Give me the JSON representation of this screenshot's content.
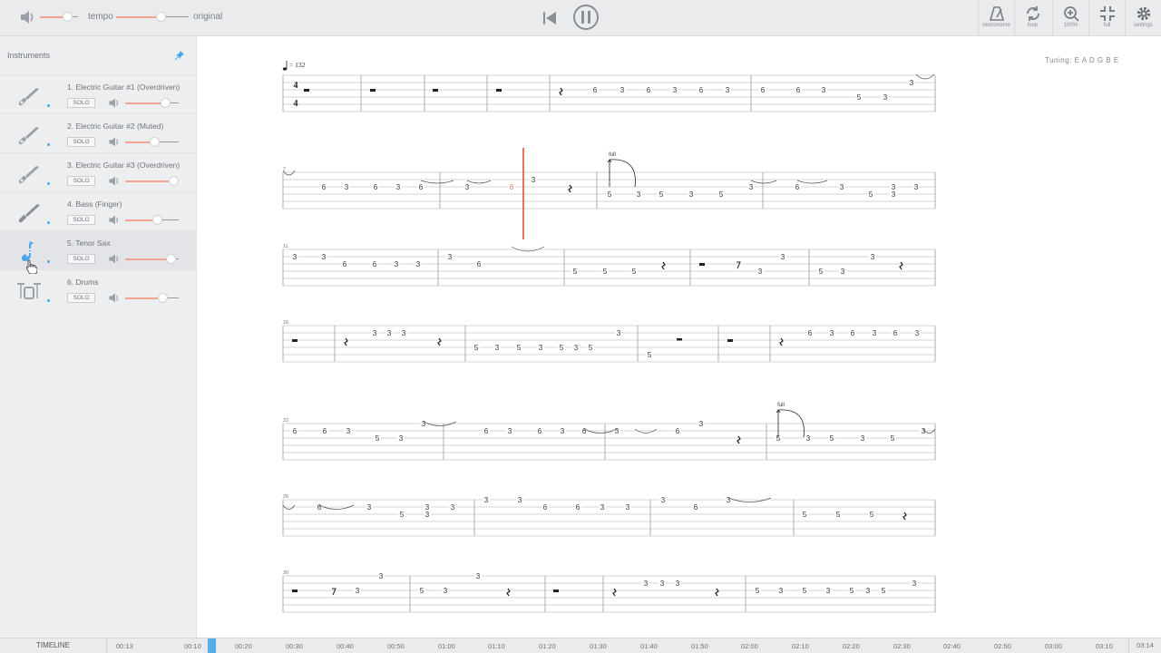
{
  "player": {
    "tempo_label": "tempo",
    "original_label": "original",
    "tools": [
      "metronome",
      "loop",
      "100%",
      "full",
      "settings"
    ],
    "playing": true
  },
  "sidebar": {
    "title": "Instruments",
    "tracks": [
      {
        "name": "1. Electric Guitar #1 (Overdriven)",
        "solo": "SOLO",
        "icon": "guitar-icon",
        "volume": 0.75
      },
      {
        "name": "2. Electric Guitar #2 (Muted)",
        "solo": "SOLO",
        "icon": "guitar-icon",
        "volume": 0.55
      },
      {
        "name": "3. Electric Guitar #3 (Overdriven)",
        "solo": "SOLO",
        "icon": "guitar-icon",
        "volume": 0.9
      },
      {
        "name": "4. Bass (Finger)",
        "solo": "SOLO",
        "icon": "bass-icon",
        "volume": 0.6
      },
      {
        "name": "5. Tenor Sax",
        "solo": "SOLO",
        "icon": "saxophone-icon",
        "volume": 0.85,
        "active": true
      },
      {
        "name": "6. Drums",
        "solo": "SOLO",
        "icon": "drums-icon",
        "volume": 0.7
      }
    ]
  },
  "score": {
    "tuning": "Tuning: E A D G B E",
    "tempo_mark": "= 132",
    "time_signature": [
      "4",
      "4"
    ],
    "bend_label": "full",
    "bar_numbers": [
      "7",
      "11",
      "16",
      "22",
      "26",
      "30"
    ],
    "rows": [
      {
        "barlines": [
          398,
          468,
          537,
          606,
          828,
          1031
        ],
        "notes": [
          [
            656,
            "6",
            2
          ],
          [
            686,
            "3",
            2
          ],
          [
            715,
            "6",
            2
          ],
          [
            744,
            "3",
            2
          ],
          [
            773,
            "6",
            2
          ],
          [
            802,
            "3",
            2
          ],
          [
            841,
            "6",
            2
          ],
          [
            880,
            "6",
            2
          ],
          [
            908,
            "3",
            2
          ],
          [
            947,
            "5",
            3
          ],
          [
            976,
            "3",
            3
          ],
          [
            1005,
            "3",
            1
          ]
        ],
        "rests": [
          [
            338,
            "w"
          ],
          [
            411,
            "w"
          ],
          [
            480,
            "w"
          ],
          [
            550,
            "w"
          ],
          [
            618,
            "q"
          ]
        ]
      },
      {
        "barlines": [
          485,
          658,
          841,
          1031
        ],
        "notes": [
          [
            357,
            "6",
            2
          ],
          [
            382,
            "3",
            2
          ],
          [
            414,
            "6",
            2
          ],
          [
            439,
            "3",
            2
          ],
          [
            464,
            "6",
            2
          ],
          [
            515,
            "3",
            2
          ],
          [
            564,
            "6",
            2,
            "hl"
          ],
          [
            588,
            "3",
            1
          ],
          [
            672,
            "5",
            3
          ],
          [
            704,
            "3",
            3
          ],
          [
            729,
            "5",
            3
          ],
          [
            762,
            "3",
            3
          ],
          [
            795,
            "5",
            3
          ],
          [
            828,
            "3",
            2
          ],
          [
            879,
            "6",
            2
          ],
          [
            928,
            "3",
            2
          ],
          [
            960,
            "5",
            3
          ],
          [
            985,
            "3",
            2
          ],
          [
            985,
            "3",
            3
          ],
          [
            1010,
            "3",
            2
          ]
        ],
        "rests": [
          [
            628,
            "q"
          ]
        ]
      },
      {
        "barlines": [
          483,
          622,
          761,
          892,
          1031
        ],
        "notes": [
          [
            325,
            "3",
            1
          ],
          [
            357,
            "3",
            1
          ],
          [
            380,
            "6",
            2
          ],
          [
            413,
            "6",
            2
          ],
          [
            437,
            "3",
            2
          ],
          [
            461,
            "3",
            2
          ],
          [
            496,
            "3",
            1
          ],
          [
            528,
            "6",
            2
          ],
          [
            634,
            "5",
            3
          ],
          [
            667,
            "5",
            3
          ],
          [
            699,
            "5",
            3
          ],
          [
            838,
            "3",
            3
          ],
          [
            863,
            "3",
            1
          ],
          [
            905,
            "5",
            3
          ],
          [
            929,
            "3",
            3
          ],
          [
            962,
            "3",
            1
          ]
        ],
        "rests": [
          [
            731,
            "q"
          ],
          [
            774,
            "w"
          ],
          [
            814,
            "e"
          ],
          [
            993,
            "q"
          ]
        ]
      },
      {
        "barlines": [
          369,
          513,
          703,
          792,
          849,
          1031
        ],
        "notes": [
          [
            413,
            "3",
            1
          ],
          [
            429,
            "3",
            1
          ],
          [
            445,
            "3",
            1
          ],
          [
            525,
            "5",
            3
          ],
          [
            548,
            "3",
            3
          ],
          [
            572,
            "5",
            3
          ],
          [
            596,
            "3",
            3
          ],
          [
            619,
            "5",
            3
          ],
          [
            635,
            "3",
            3
          ],
          [
            651,
            "5",
            3
          ],
          [
            682,
            "3",
            1
          ],
          [
            716,
            "5",
            4
          ],
          [
            893,
            "6",
            1
          ],
          [
            917,
            "3",
            1
          ],
          [
            940,
            "6",
            1
          ],
          [
            964,
            "3",
            1
          ],
          [
            987,
            "6",
            1
          ],
          [
            1011,
            "3",
            1
          ]
        ],
        "rests": [
          [
            325,
            "w"
          ],
          [
            381,
            "q"
          ],
          [
            484,
            "q"
          ],
          [
            749,
            "h"
          ],
          [
            805,
            "w"
          ],
          [
            861,
            "q"
          ]
        ]
      },
      {
        "barlines": [
          489,
          667,
          845,
          1031
        ],
        "notes": [
          [
            325,
            "6",
            1
          ],
          [
            358,
            "6",
            1
          ],
          [
            384,
            "3",
            1
          ],
          [
            416,
            "5",
            2
          ],
          [
            442,
            "3",
            2
          ],
          [
            467,
            "3",
            0
          ],
          [
            536,
            "6",
            1
          ],
          [
            562,
            "3",
            1
          ],
          [
            595,
            "6",
            1
          ],
          [
            620,
            "3",
            1
          ],
          [
            644,
            "6",
            1
          ],
          [
            680,
            "3",
            1
          ],
          [
            747,
            "6",
            1
          ],
          [
            773,
            "3",
            0
          ],
          [
            858,
            "5",
            2
          ],
          [
            891,
            "3",
            2
          ],
          [
            917,
            "5",
            2
          ],
          [
            951,
            "3",
            2
          ],
          [
            984,
            "5",
            2
          ],
          [
            1018,
            "3",
            1
          ]
        ],
        "rests": [
          [
            814,
            "q"
          ]
        ]
      },
      {
        "barlines": [
          523,
          717,
          875,
          1031
        ],
        "notes": [
          [
            352,
            "6",
            1
          ],
          [
            407,
            "3",
            1
          ],
          [
            443,
            "5",
            2
          ],
          [
            471,
            "3",
            1
          ],
          [
            471,
            "3",
            2
          ],
          [
            499,
            "3",
            1
          ],
          [
            536,
            "3",
            0
          ],
          [
            573,
            "3",
            0
          ],
          [
            601,
            "6",
            1
          ],
          [
            637,
            "6",
            1
          ],
          [
            664,
            "3",
            1
          ],
          [
            692,
            "3",
            1
          ],
          [
            731,
            "3",
            0
          ],
          [
            767,
            "6",
            1
          ],
          [
            803,
            "3",
            0
          ],
          [
            887,
            "5",
            2
          ],
          [
            924,
            "5",
            2
          ],
          [
            961,
            "5",
            2
          ]
        ],
        "rests": [
          [
            997,
            "q"
          ]
        ]
      },
      {
        "barlines": [
          452,
          601,
          665,
          822,
          1031
        ],
        "notes": [
          [
            394,
            "3",
            2
          ],
          [
            420,
            "3",
            0
          ],
          [
            465,
            "5",
            2
          ],
          [
            491,
            "3",
            2
          ],
          [
            527,
            "3",
            0
          ],
          [
            712,
            "3",
            1
          ],
          [
            730,
            "3",
            1
          ],
          [
            747,
            "3",
            1
          ],
          [
            835,
            "5",
            2
          ],
          [
            861,
            "3",
            2
          ],
          [
            887,
            "5",
            2
          ],
          [
            913,
            "3",
            2
          ],
          [
            939,
            "5",
            2
          ],
          [
            957,
            "3",
            2
          ],
          [
            974,
            "5",
            2
          ],
          [
            1008,
            "3",
            1
          ]
        ],
        "rests": [
          [
            325,
            "w"
          ],
          [
            368,
            "e"
          ],
          [
            560,
            "q"
          ],
          [
            613,
            "w"
          ],
          [
            677,
            "q"
          ],
          [
            790,
            "q"
          ]
        ]
      }
    ]
  },
  "timeline": {
    "label": "TIMELINE",
    "ticks": [
      "00:13",
      "00:10",
      "00:20",
      "00:30",
      "00:40",
      "00:50",
      "01:00",
      "01:10",
      "01:20",
      "01:30",
      "01:40",
      "01:50",
      "02:00",
      "02:10",
      "02:20",
      "02:30",
      "02:40",
      "02:50",
      "03:00",
      "03:10"
    ],
    "end": "03:14"
  }
}
